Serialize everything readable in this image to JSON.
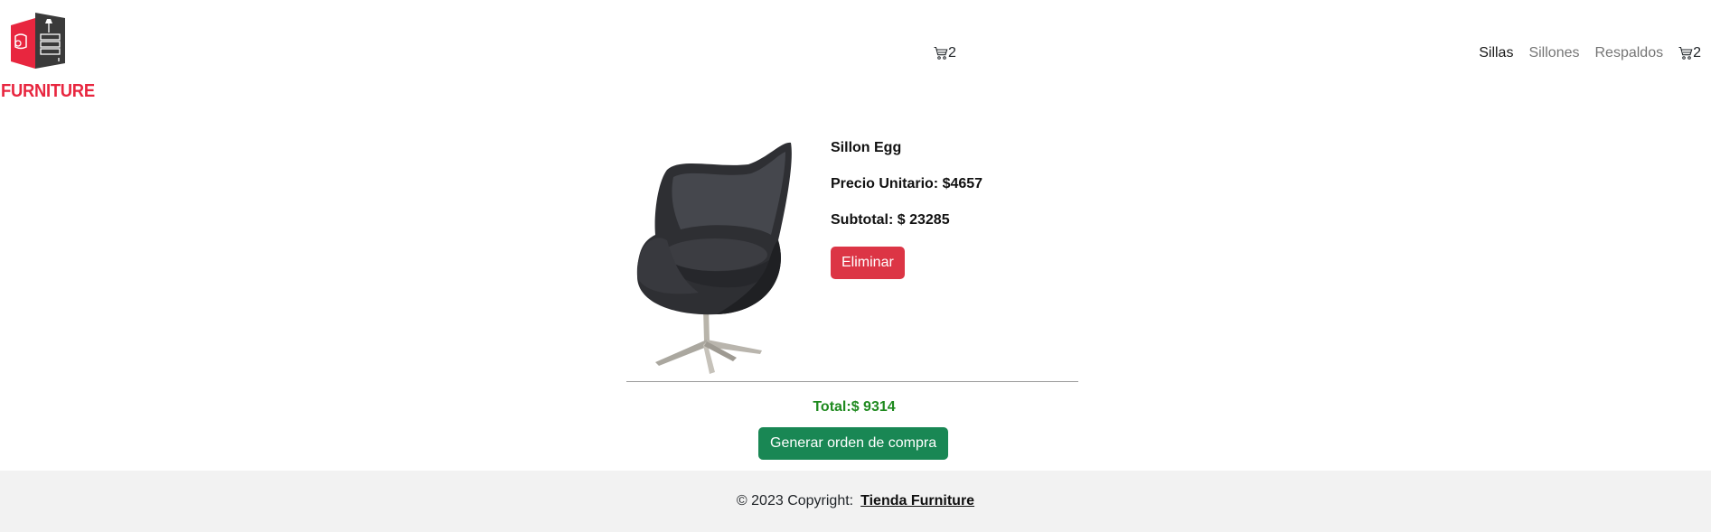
{
  "brand": {
    "logo_text": "FURNITURE",
    "accent_color": "#e8263f"
  },
  "header": {
    "center_cart_count": "2",
    "nav": [
      {
        "label": "Sillas",
        "active": true
      },
      {
        "label": "Sillones",
        "active": false
      },
      {
        "label": "Respaldos",
        "active": false
      }
    ],
    "cart_count": "2",
    "cart_icon": "cart-icon"
  },
  "cart_item": {
    "name": "Sillon Egg",
    "unit_price": "Precio Unitario: $4657",
    "subtotal": "Subtotal: $ 23285",
    "remove_label": "Eliminar",
    "image_icon": "egg-chair-image"
  },
  "summary": {
    "total": "Total:$ 9314",
    "order_label": "Generar orden de compra",
    "total_color": "#1f8a1f",
    "order_color": "#198754",
    "remove_color": "#dc3545"
  },
  "footer": {
    "copyright": "© 2023 Copyright:",
    "store_link": "Tienda Furniture"
  }
}
